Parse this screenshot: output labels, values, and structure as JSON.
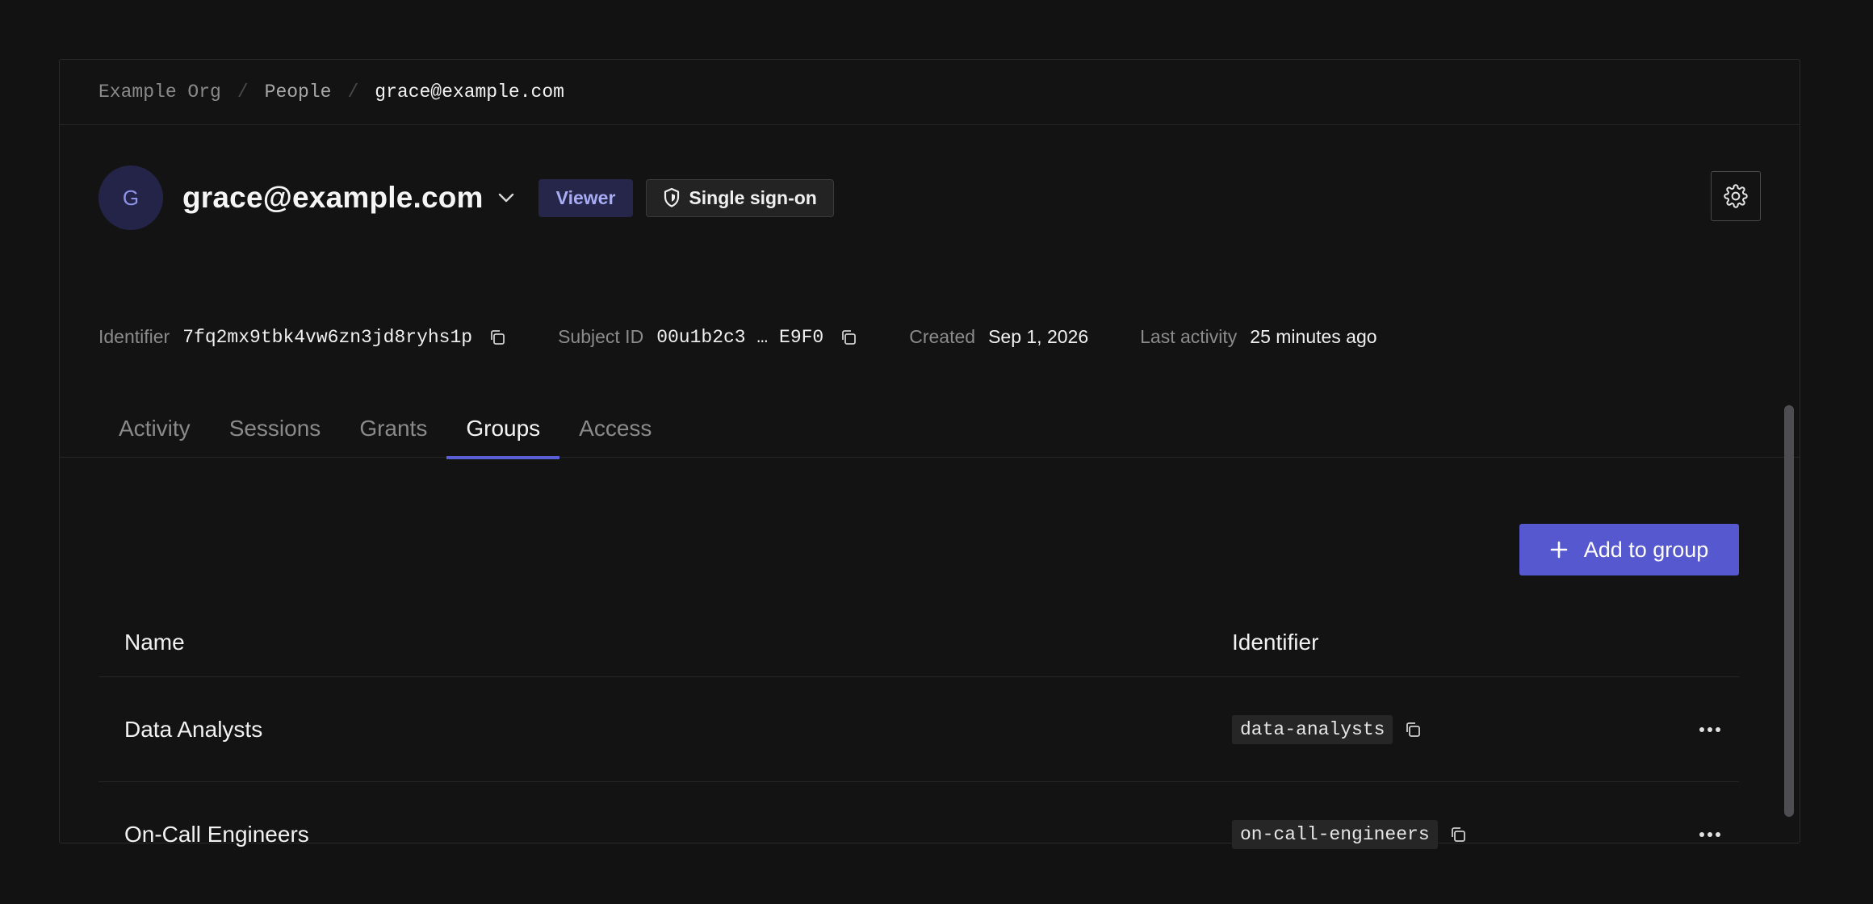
{
  "breadcrumb": {
    "org": "Example Org",
    "section": "People",
    "current": "grace@example.com",
    "separator": "/"
  },
  "user": {
    "initial": "G",
    "email": "grace@example.com",
    "role_badge": "Viewer",
    "auth_badge": "Single sign-on"
  },
  "meta": {
    "identifier_label": "Identifier",
    "identifier_value": "7fq2mx9tbk4vw6zn3jd8ryhs1p",
    "subject_label": "Subject ID",
    "subject_value": "00u1b2c3 … E9F0",
    "created_label": "Created",
    "created_value": "Sep 1, 2026",
    "activity_label": "Last activity",
    "activity_value": "25 minutes ago"
  },
  "tabs": [
    {
      "label": "Activity"
    },
    {
      "label": "Sessions"
    },
    {
      "label": "Grants"
    },
    {
      "label": "Groups",
      "active": true
    },
    {
      "label": "Access"
    }
  ],
  "actions": {
    "add_group": "Add to group"
  },
  "table": {
    "headers": {
      "name": "Name",
      "identifier": "Identifier"
    },
    "rows": [
      {
        "name": "Data Analysts",
        "identifier": "data-analysts"
      },
      {
        "name": "On-Call Engineers",
        "identifier": "on-call-engineers"
      }
    ]
  },
  "colors": {
    "accent": "#5658cf",
    "background": "#121212",
    "viewer_badge_bg": "#25264a",
    "viewer_badge_text": "#a8acf4"
  },
  "icons": {
    "chevron": "chevron-down-icon",
    "shield": "shield-icon",
    "settings": "gear-icon",
    "copy": "copy-icon",
    "plus": "plus-icon",
    "more": "more-horizontal-icon"
  }
}
